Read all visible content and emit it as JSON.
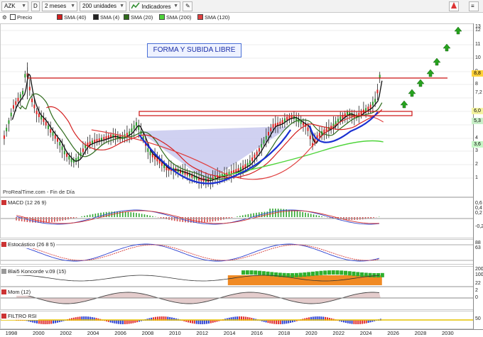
{
  "toolbar": {
    "symbol": "AZK",
    "chart_type_icon": "candlestick-icon",
    "period_letter": "D",
    "timeframe": "2 meses",
    "units": "200 unidades",
    "indicators_label": "Indicadores"
  },
  "legend": {
    "price": "Precio",
    "sma40": "SMA (40)",
    "sma4": "SMA (4)",
    "sma20": "SMA (20)",
    "sma200": "SMA (200)",
    "sma120": "SMA (120)"
  },
  "colors": {
    "price": "#111111",
    "sma40": "#d42020",
    "sma4": "#111111",
    "sma20": "#2e6b1b",
    "sma200": "#4ed43a",
    "sma120": "#e04040",
    "resistance": "#cc1111",
    "cup": "#1a2fd1",
    "cup_fill": "#c8c9ee",
    "target_arrow": "#26a31e"
  },
  "annotation": "FORMA Y SUBIDA LIBRE",
  "source_note": "ProRealTime.com - Fin de Día",
  "price_axis": {
    "ticks": [
      "13",
      "12",
      "11",
      "10",
      "9",
      "8",
      "7,2",
      "6",
      "5,3",
      "4",
      "3,6",
      "3",
      "2",
      "1"
    ],
    "current_price": "8,8",
    "tags": [
      "6,0",
      "5,3",
      "3,6"
    ]
  },
  "time_axis": [
    "1998",
    "2000",
    "2002",
    "2004",
    "2006",
    "2008",
    "2010",
    "2012",
    "2014",
    "2016",
    "2018",
    "2020",
    "2022",
    "2024",
    "2026",
    "2028",
    "2030"
  ],
  "panels": {
    "macd": {
      "label": "MACD (12 26 9)",
      "values": [
        "0,6",
        "0,4",
        "0,2"
      ],
      "zero": "-0,2"
    },
    "stoch": {
      "label": "Estocástico (26 8 5)",
      "values": [
        "88",
        "63"
      ]
    },
    "koncorde": {
      "label": "Blai5 Koncorde v.09 (15)",
      "values": [
        "200",
        "100",
        "22"
      ]
    },
    "mom": {
      "label": "Mom (12)",
      "values": [
        "2",
        "0"
      ]
    },
    "rsi": {
      "label": "FILTRO RSI",
      "values": [
        "50"
      ]
    }
  }
}
